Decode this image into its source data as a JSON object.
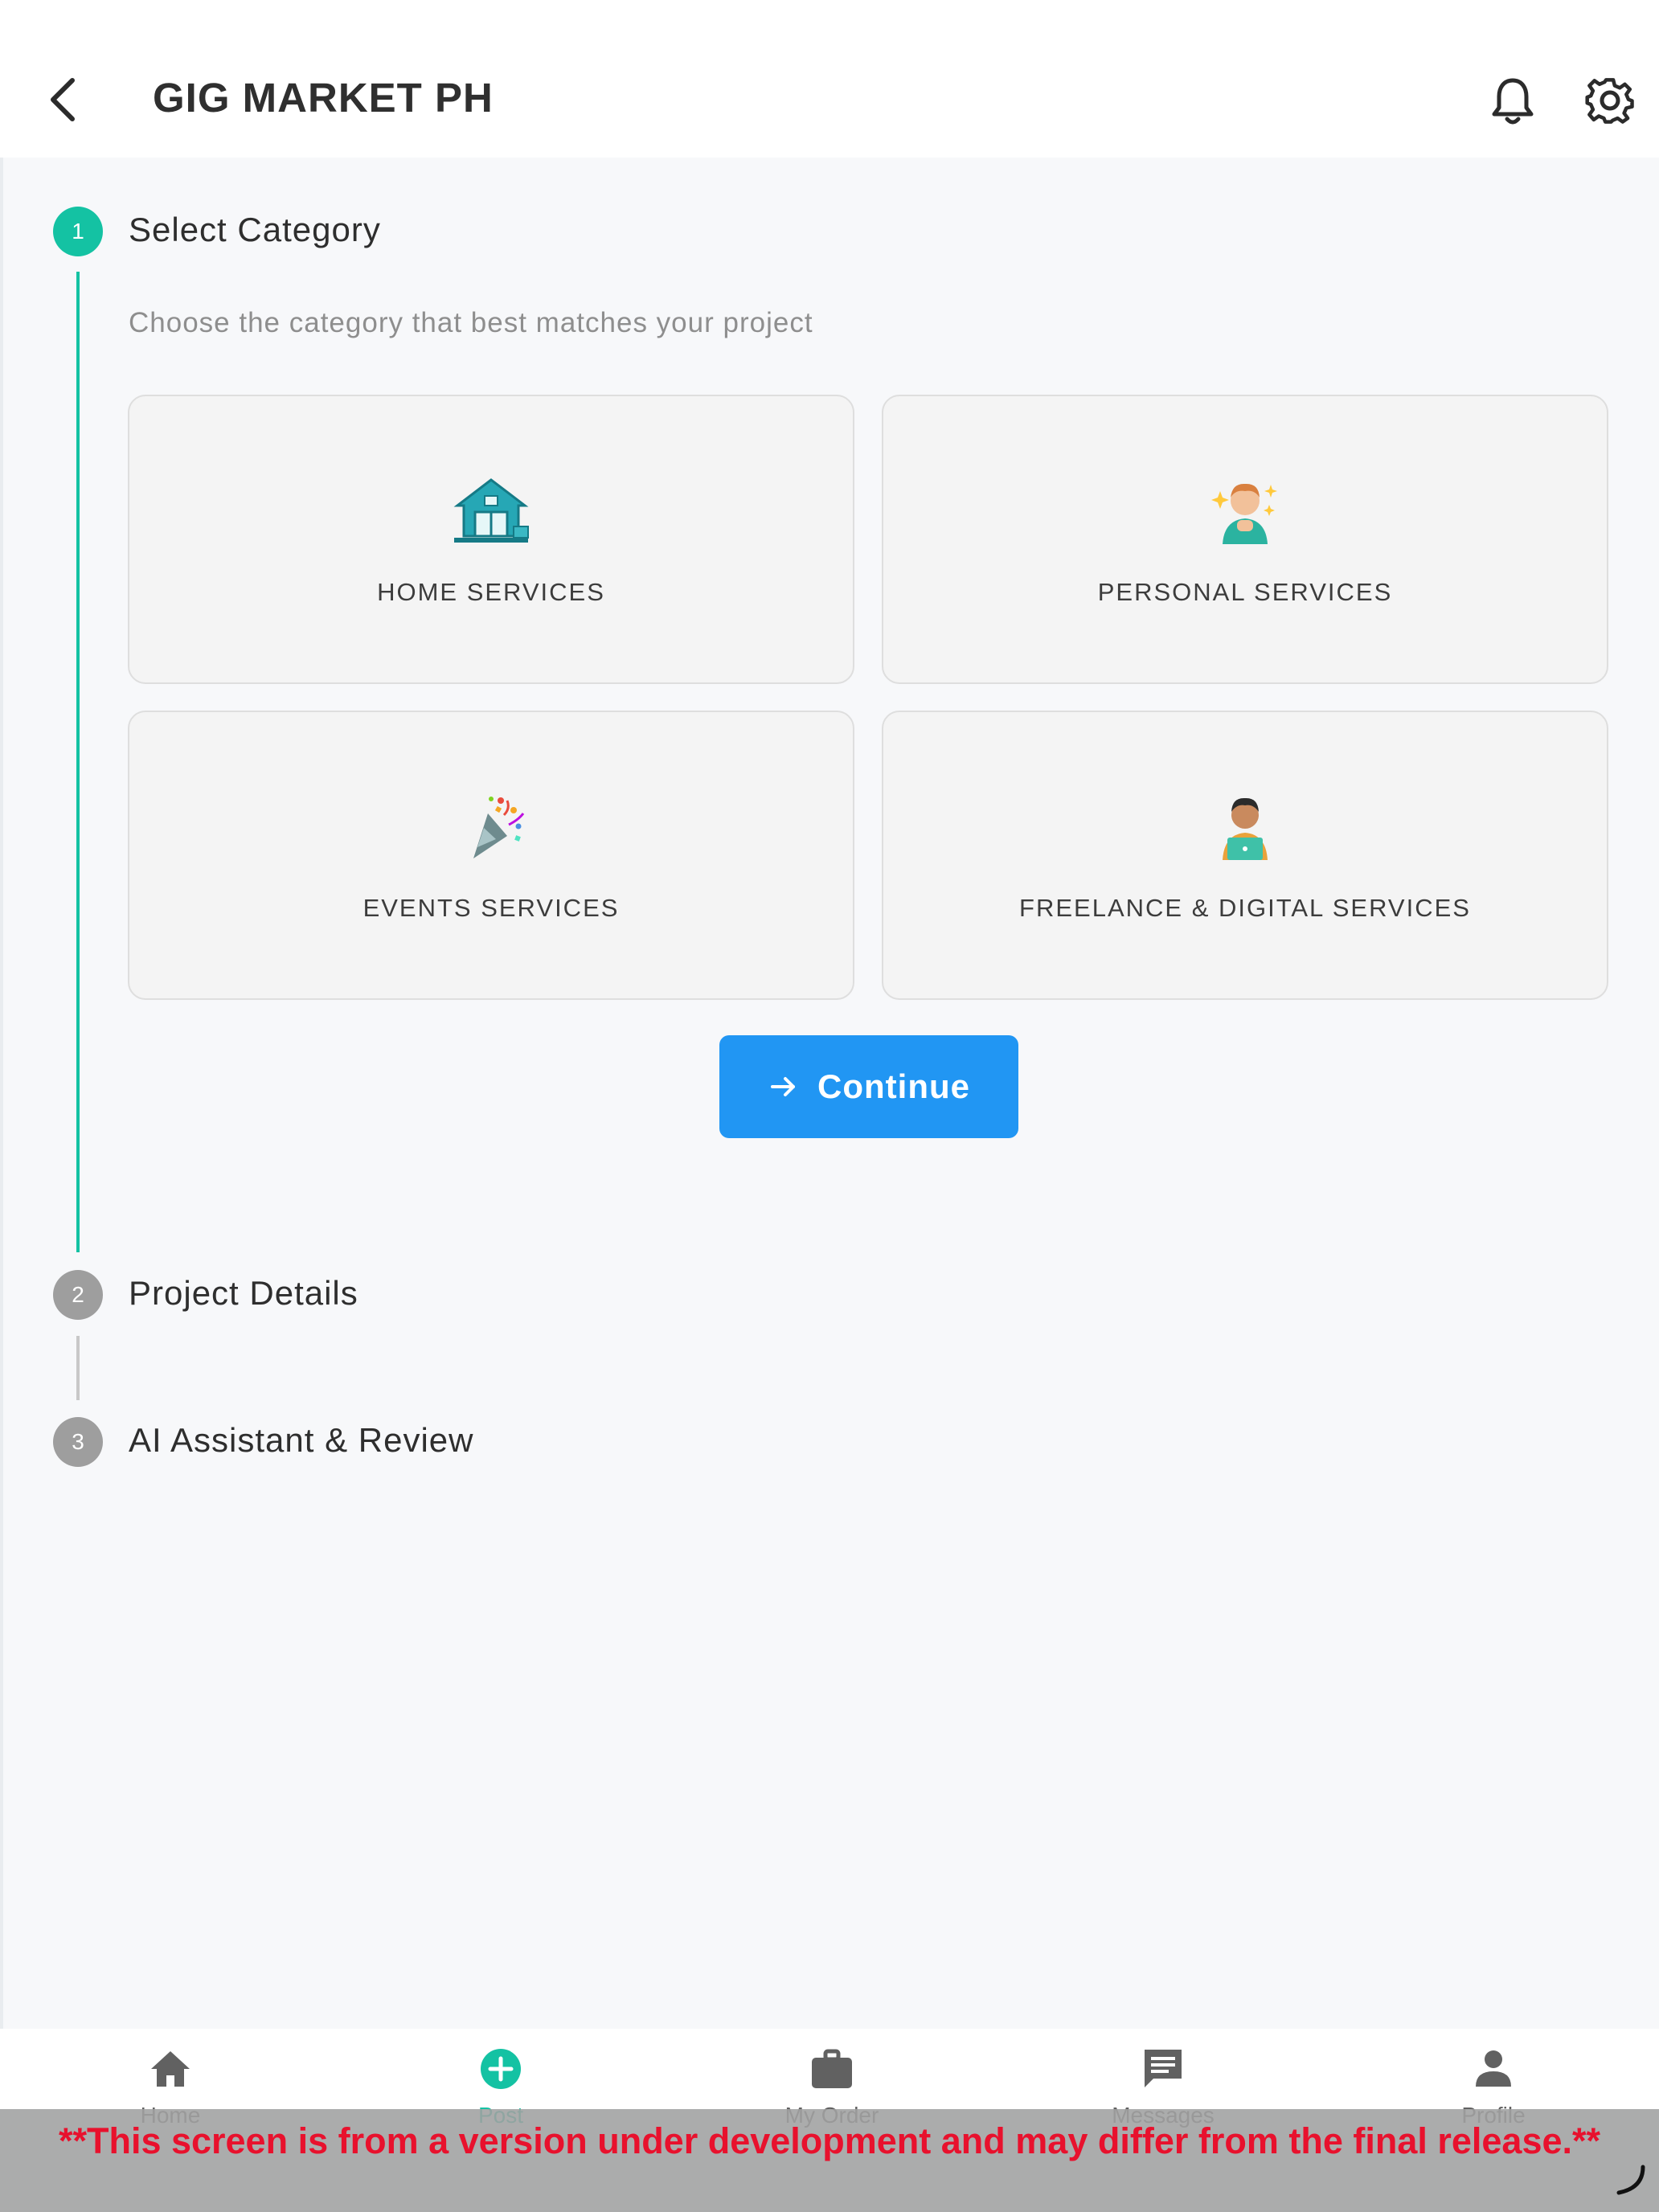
{
  "header": {
    "title": "GIG MARKET PH",
    "back_icon": "chevron-left-icon",
    "notification_icon": "bell-icon",
    "settings_icon": "gear-icon"
  },
  "stepper": {
    "steps": [
      {
        "number": "1",
        "title": "Select Category",
        "state": "active"
      },
      {
        "number": "2",
        "title": "Project Details",
        "state": "inactive"
      },
      {
        "number": "3",
        "title": "AI Assistant & Review",
        "state": "inactive"
      }
    ],
    "subtitle": "Choose the category that best matches your project",
    "categories": [
      {
        "label": "HOME SERVICES",
        "icon": "house-icon"
      },
      {
        "label": "PERSONAL SERVICES",
        "icon": "person-sparkle-icon"
      },
      {
        "label": "EVENTS SERVICES",
        "icon": "party-popper-icon"
      },
      {
        "label": "FREELANCE & DIGITAL SERVICES",
        "icon": "person-laptop-icon"
      }
    ],
    "continue_label": "Continue"
  },
  "bottom_nav": [
    {
      "label": "Home",
      "icon": "home-icon"
    },
    {
      "label": "Post",
      "icon": "add-circle-icon",
      "active": true
    },
    {
      "label": "My Order",
      "icon": "briefcase-icon"
    },
    {
      "label": "Messages",
      "icon": "message-icon"
    },
    {
      "label": "Profile",
      "icon": "person-icon"
    }
  ],
  "banner": {
    "text": "**This screen is from a version under development and may differ from the final release.**"
  },
  "colors": {
    "accent": "#14c2a3",
    "primary_button": "#2196f3",
    "banner_text": "#e8112d"
  }
}
